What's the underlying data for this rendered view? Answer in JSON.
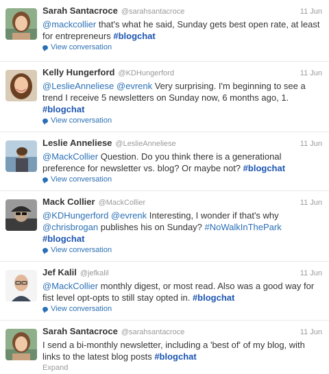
{
  "tweets": [
    {
      "name": "Sarah Santacroce",
      "handle": "@sarahsantacroce",
      "time": "11 Jun",
      "avatar_icon": "woman-short-brown-hair-avatar",
      "parts": [
        {
          "t": "@mackcollier",
          "k": "mention"
        },
        {
          "t": " that's what he said, Sunday gets best open rate, at least for entrepreneurs ",
          "k": "text"
        },
        {
          "t": "#blogchat",
          "k": "hashtag"
        }
      ],
      "meta": "View conversation"
    },
    {
      "name": "Kelly Hungerford",
      "handle": "@KDHungerford",
      "time": "11 Jun",
      "avatar_icon": "woman-long-brown-hair-avatar",
      "parts": [
        {
          "t": "@LeslieAnneliese",
          "k": "mention"
        },
        {
          "t": " ",
          "k": "text"
        },
        {
          "t": "@evrenk",
          "k": "mention"
        },
        {
          "t": " Very surprising. I'm beginning to see a trend I receive 5 newsletters on Sunday now, 6 months ago, 1. ",
          "k": "text"
        },
        {
          "t": "#blogchat",
          "k": "hashtag"
        }
      ],
      "meta": "View conversation"
    },
    {
      "name": "Leslie Anneliese",
      "handle": "@LeslieAnneliese",
      "time": "11 Jun",
      "avatar_icon": "woman-outdoor-water-avatar",
      "parts": [
        {
          "t": "@MackCollier",
          "k": "mention"
        },
        {
          "t": " Question. Do you think there is a generational preference for newsletter vs. blog? Or maybe not? ",
          "k": "text"
        },
        {
          "t": "#blogchat",
          "k": "hashtag"
        }
      ],
      "meta": "View conversation"
    },
    {
      "name": "Mack Collier",
      "handle": "@MackCollier",
      "time": "11 Jun",
      "avatar_icon": "man-cap-sunglasses-avatar",
      "parts": [
        {
          "t": "@KDHungerford",
          "k": "mention"
        },
        {
          "t": " ",
          "k": "text"
        },
        {
          "t": "@evrenk",
          "k": "mention"
        },
        {
          "t": " Interesting, I wonder if that's why ",
          "k": "text"
        },
        {
          "t": "@chrisbrogan",
          "k": "mention"
        },
        {
          "t": " publishes his on Sunday? ",
          "k": "text"
        },
        {
          "t": "#NoWalkInThePark",
          "k": "hashtag-plain"
        },
        {
          "t": " ",
          "k": "text"
        },
        {
          "t": "#blogchat",
          "k": "hashtag"
        }
      ],
      "meta": "View conversation"
    },
    {
      "name": "Jef Kalil",
      "handle": "@jefkalil",
      "time": "11 Jun",
      "avatar_icon": "bald-man-glasses-avatar",
      "parts": [
        {
          "t": "@MackCollier",
          "k": "mention"
        },
        {
          "t": " monthly digest, or most read. Also was a good way for fist level opt-opts to still stay opted in. ",
          "k": "text"
        },
        {
          "t": "#blogchat",
          "k": "hashtag"
        }
      ],
      "meta": "View conversation"
    },
    {
      "name": "Sarah Santacroce",
      "handle": "@sarahsantacroce",
      "time": "11 Jun",
      "avatar_icon": "woman-short-brown-hair-avatar",
      "parts": [
        {
          "t": "I send a bi-monthly newsletter, including a 'best of' of my blog, with links to the latest blog posts ",
          "k": "text"
        },
        {
          "t": "#blogchat",
          "k": "hashtag"
        }
      ],
      "meta": "Expand"
    }
  ],
  "colors": {
    "link": "#2a6fb5",
    "hashtag": "#1c55b0",
    "muted": "#999999",
    "divider": "#e8e8e8"
  }
}
